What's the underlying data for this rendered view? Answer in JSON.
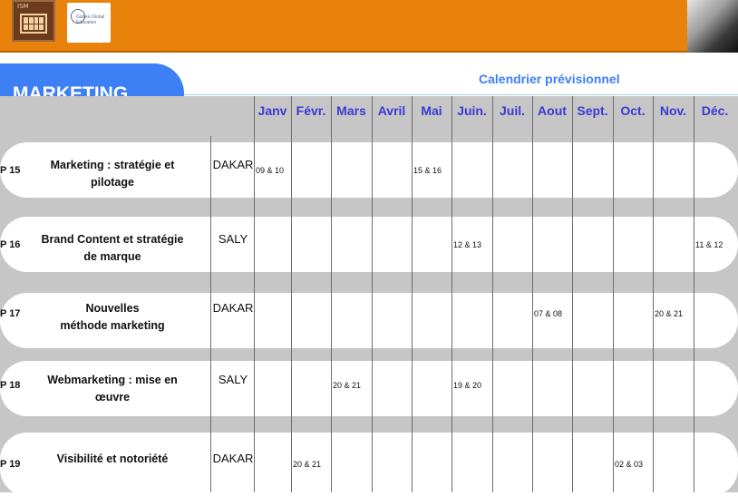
{
  "header": {
    "ism_logo_text": "ISM",
    "galileo_logo_text": "Galileo Global Education"
  },
  "title": "MARKETING",
  "subtitle": "Calendrier prévisionnel",
  "months": [
    "Janv",
    "Févr.",
    "Mars",
    "Avril",
    "Mai",
    "Juin.",
    "Juil.",
    "Aout",
    "Sept.",
    "Oct.",
    "Nov.",
    "Déc."
  ],
  "rows": [
    {
      "code": "P 15",
      "course_line1": "Marketing : stratégie et",
      "course_line2": "pilotage",
      "city": "DAKAR",
      "dates": {
        "Janv": "09 & 10",
        "Mai": "15 & 16"
      }
    },
    {
      "code": "P 16",
      "course_line1": "Brand Content et stratégie",
      "course_line2": "de marque",
      "city": "SALY",
      "dates": {
        "Juin.": "12 & 13",
        "Déc.": "11 & 12"
      }
    },
    {
      "code": "P 17",
      "course_line1": "Nouvelles",
      "course_line2": "méthode marketing",
      "city": "DAKAR",
      "dates": {
        "Aout": "07 & 08",
        "Nov.": "20 & 21"
      }
    },
    {
      "code": "P 18",
      "course_line1": "Webmarketing : mise en",
      "course_line2": "œuvre",
      "city": "SALY",
      "dates": {
        "Mars": "20 & 21",
        "Juin.": "19 & 20"
      }
    },
    {
      "code": "P 19",
      "course_line1": "Visibilité et notoriété",
      "course_line2": "",
      "city": "DAKAR",
      "dates": {
        "Févr.": "20 & 21",
        "Oct.": "02 & 03"
      }
    }
  ]
}
